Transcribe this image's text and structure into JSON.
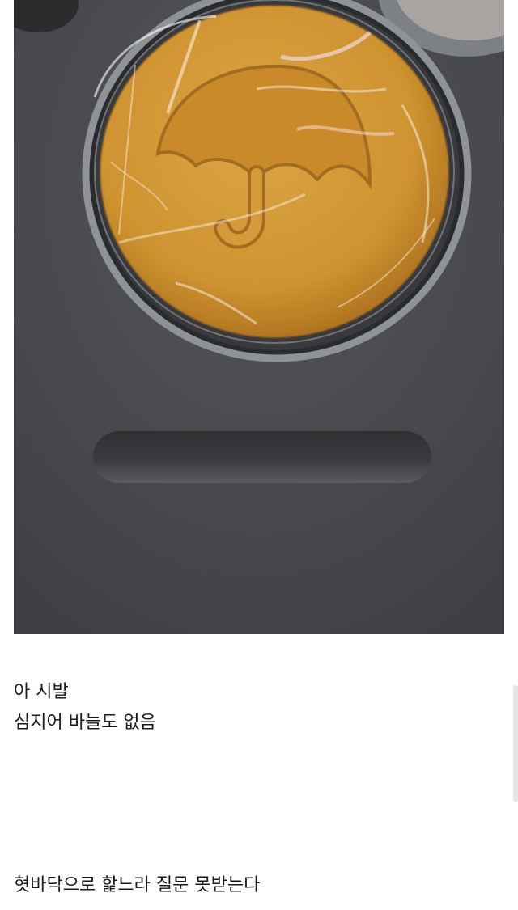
{
  "photo": {
    "subject": "dalgona-candy-in-tin",
    "shape": "umbrella-icon",
    "colors": {
      "mat": "#4a4b4d",
      "tin_rim": "#8a8d92",
      "candy": "#d49a34",
      "candy_dark": "#b77a22",
      "wrap_highlight": "#ffffff"
    }
  },
  "captions": [
    {
      "text": "아 시발"
    },
    {
      "text": "심지어 바늘도 없음"
    },
    {
      "text": "혓바닥으로 핥느라 질문 못받는다"
    }
  ]
}
